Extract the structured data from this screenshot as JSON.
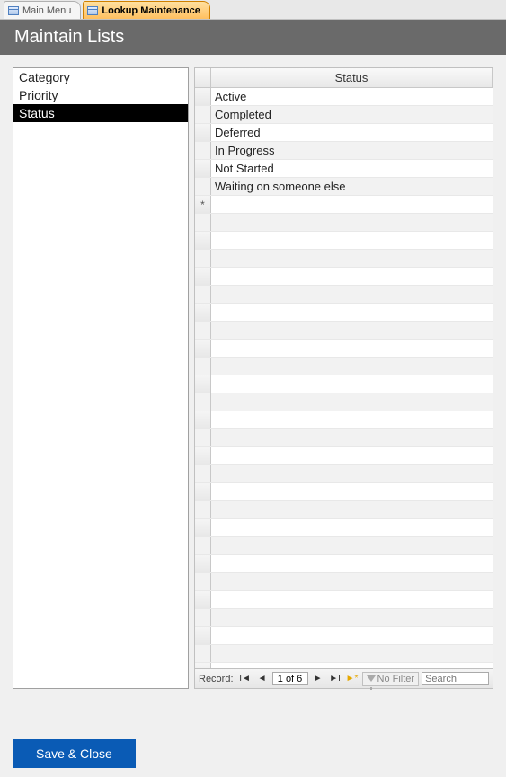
{
  "tabs": [
    {
      "label": "Main Menu",
      "active": false
    },
    {
      "label": "Lookup Maintenance",
      "active": true
    }
  ],
  "title": "Maintain Lists",
  "side_items": [
    {
      "label": "Category",
      "selected": false
    },
    {
      "label": "Priority",
      "selected": false
    },
    {
      "label": "Status",
      "selected": true
    }
  ],
  "grid": {
    "column_header": "Status",
    "rows": [
      "Active",
      "Completed",
      "Deferred",
      "In Progress",
      "Not Started",
      "Waiting on someone else"
    ],
    "new_row_marker": "*"
  },
  "nav": {
    "label": "Record:",
    "position": "1 of 6",
    "filter_label": "No Filter",
    "search_placeholder": "Search"
  },
  "footer": {
    "save_label": "Save & Close"
  }
}
